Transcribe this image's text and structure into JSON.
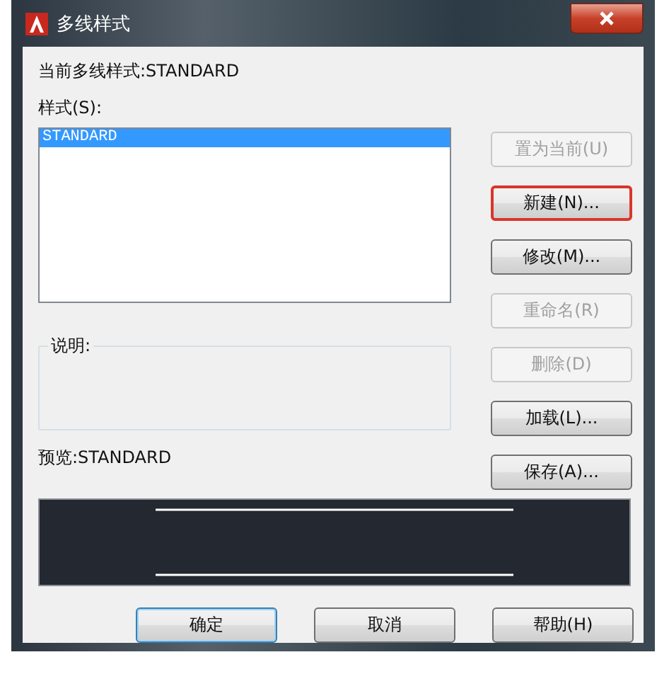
{
  "window": {
    "title": "多线样式"
  },
  "current_style": "当前多线样式:STANDARD",
  "styles_label": "样式(S):",
  "styles": [
    {
      "name": "STANDARD",
      "selected": true
    }
  ],
  "buttons": [
    {
      "label": "置为当前(U)",
      "disabled": true,
      "highlighted": false
    },
    {
      "label": "新建(N)...",
      "disabled": false,
      "highlighted": true
    },
    {
      "label": "修改(M)...",
      "disabled": false,
      "highlighted": false
    },
    {
      "label": "重命名(R)",
      "disabled": true,
      "highlighted": false
    },
    {
      "label": "删除(D)",
      "disabled": true,
      "highlighted": false
    },
    {
      "label": "加载(L)...",
      "disabled": false,
      "highlighted": false
    },
    {
      "label": "保存(A)...",
      "disabled": false,
      "highlighted": false
    }
  ],
  "description": {
    "label": "说明:"
  },
  "preview": {
    "label": "预览:STANDARD"
  },
  "footer_buttons": [
    {
      "label": "确定",
      "default": true
    },
    {
      "label": "取消",
      "default": false
    },
    {
      "label": "帮助(H)",
      "default": false
    }
  ]
}
